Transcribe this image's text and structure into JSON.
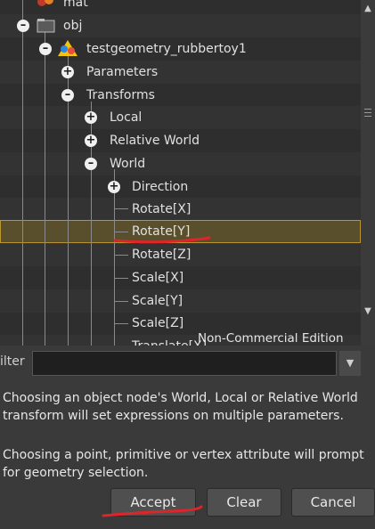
{
  "tree": {
    "rows": [
      {
        "label": "mat",
        "icon": "material-node-icon"
      },
      {
        "label": "obj",
        "icon": "object-network-icon"
      },
      {
        "label": "testgeometry_rubbertoy1",
        "icon": "geometry-node-icon"
      },
      {
        "label": "Parameters",
        "expander": "+"
      },
      {
        "label": "Transforms",
        "expander": "-"
      },
      {
        "label": "Local",
        "expander": "+"
      },
      {
        "label": "Relative World",
        "expander": "+"
      },
      {
        "label": "World",
        "expander": "-"
      },
      {
        "label": "Direction",
        "expander": "+"
      },
      {
        "label": "Rotate[X]"
      },
      {
        "label": "Rotate[Y]",
        "selected": true
      },
      {
        "label": "Rotate[Z]"
      },
      {
        "label": "Scale[X]"
      },
      {
        "label": "Scale[Y]"
      },
      {
        "label": "Scale[Z]"
      },
      {
        "label": "Translate[X]"
      }
    ]
  },
  "watermark": "Non-Commercial Edition",
  "filter": {
    "label": "ilter",
    "value": ""
  },
  "help": {
    "paragraph1": "Choosing an object node's World, Local or Relative World transform will set expressions on multiple parameters.",
    "paragraph2": "Choosing a point, primitive or vertex attribute will prompt for geometry selection."
  },
  "buttons": {
    "accept": "Accept",
    "clear": "Clear",
    "cancel": "Cancel"
  },
  "colors": {
    "selection": "#b9962f",
    "annotation": "#e0242a"
  }
}
